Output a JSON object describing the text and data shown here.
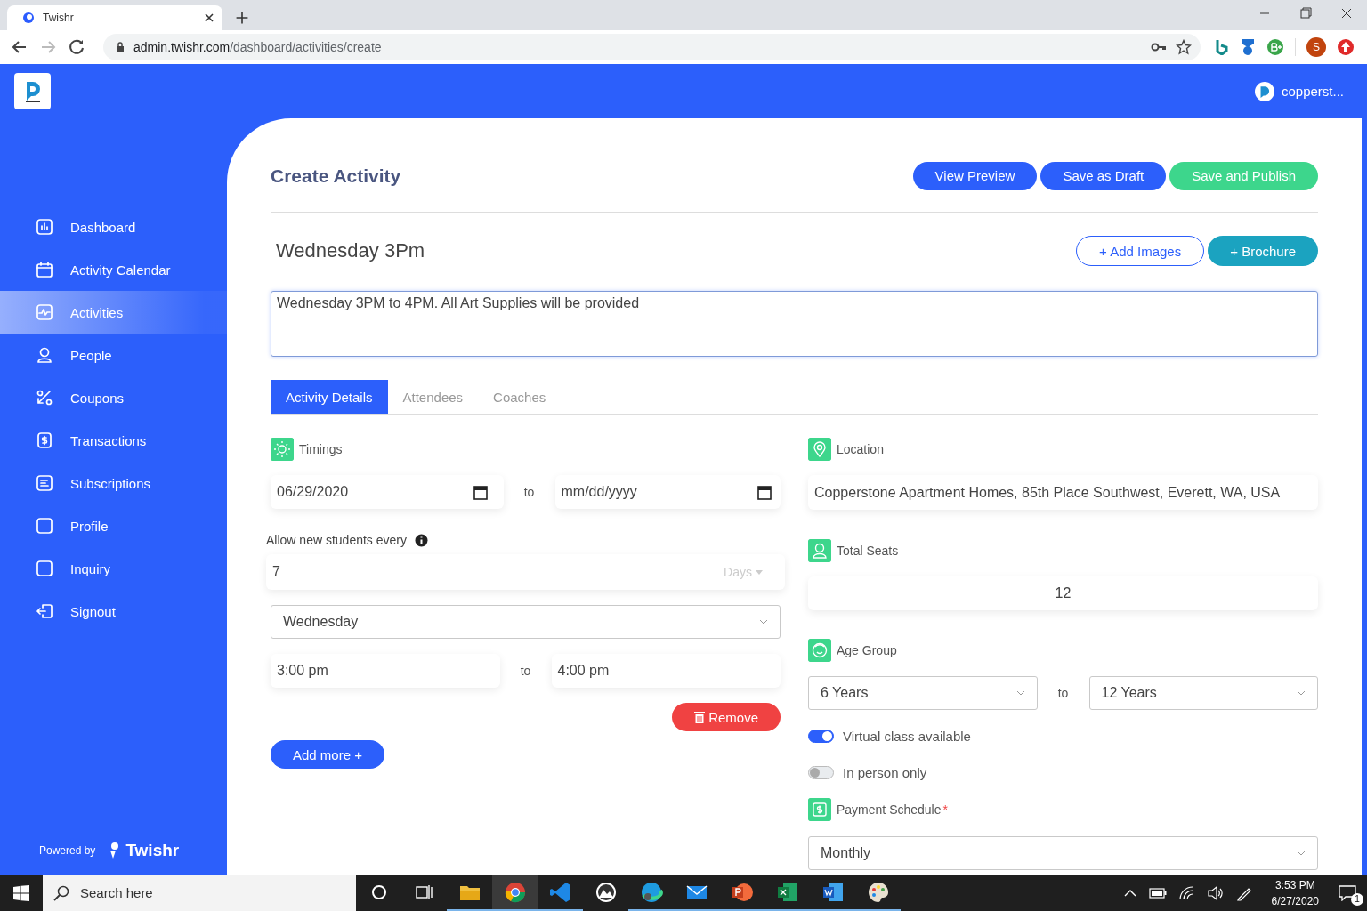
{
  "browser": {
    "tab_title": "Twishr",
    "url_host": "admin.twishr.com",
    "url_path": "/dashboard/activities/create",
    "profile_initial": "S"
  },
  "header": {
    "user": "copperst..."
  },
  "sidebar": {
    "items": [
      {
        "label": "Dashboard",
        "selected": false
      },
      {
        "label": "Activity Calendar",
        "selected": false
      },
      {
        "label": "Activities",
        "selected": true
      },
      {
        "label": "People",
        "selected": false
      },
      {
        "label": "Coupons",
        "selected": false
      },
      {
        "label": "Transactions",
        "selected": false
      },
      {
        "label": "Subscriptions",
        "selected": false
      },
      {
        "label": "Profile",
        "selected": false
      },
      {
        "label": "Inquiry",
        "selected": false
      },
      {
        "label": "Signout",
        "selected": false
      }
    ],
    "powered_by": "Powered by",
    "brand": "Twishr"
  },
  "page": {
    "title": "Create Activity",
    "actions": [
      {
        "label": "View Preview",
        "kind": "primary"
      },
      {
        "label": "Save as Draft",
        "kind": "primary"
      },
      {
        "label": "Save and Publish",
        "kind": "success"
      }
    ],
    "activity_name": "Wednesday 3Pm",
    "media_buttons": [
      {
        "label": "+ Add Images",
        "kind": "outline"
      },
      {
        "label": "+ Brochure",
        "kind": "teal"
      }
    ],
    "description": "Wednesday 3PM to 4PM. All Art Supplies will be provided"
  },
  "tabs": [
    {
      "label": "Activity Details",
      "selected": true
    },
    {
      "label": "Attendees",
      "selected": false
    },
    {
      "label": "Coaches",
      "selected": false
    }
  ],
  "timings": {
    "label": "Timings",
    "start_date": "06/29/2020",
    "date_separator": "to",
    "end_date_placeholder": "mm/dd/yyyy",
    "allow_label": "Allow new students every",
    "allow_value": "7",
    "allow_unit": "Days",
    "day": "Wednesday",
    "start_time": "3:00 pm",
    "time_separator": "to",
    "end_time": "4:00 pm",
    "remove_button": "Remove",
    "add_more_button": "Add more +"
  },
  "details": {
    "location_label": "Location",
    "location": "Copperstone Apartment Homes, 85th Place Southwest, Everett, WA, USA",
    "seats_label": "Total Seats",
    "seats": "12",
    "age_label": "Age Group",
    "age_from": "6 Years",
    "age_separator": "to",
    "age_to": "12 Years",
    "toggles": [
      {
        "label": "Virtual class available",
        "on": true
      },
      {
        "label": "In person only",
        "on": false
      }
    ],
    "payment_label": "Payment Schedule",
    "required_mark": "*",
    "payment": "Monthly"
  },
  "taskbar": {
    "search_placeholder": "Search here",
    "apps": [
      {
        "selected": false,
        "running": true
      },
      {
        "selected": true,
        "running": true
      },
      {
        "selected": false,
        "running": true
      },
      {
        "selected": false,
        "running": false
      },
      {
        "selected": false,
        "running": true
      },
      {
        "selected": false,
        "running": true
      },
      {
        "selected": false,
        "running": true
      },
      {
        "selected": false,
        "running": true
      },
      {
        "selected": false,
        "running": true
      },
      {
        "selected": false,
        "running": true
      }
    ],
    "time": "3:53 PM",
    "date": "6/27/2020",
    "notifications": "1"
  }
}
